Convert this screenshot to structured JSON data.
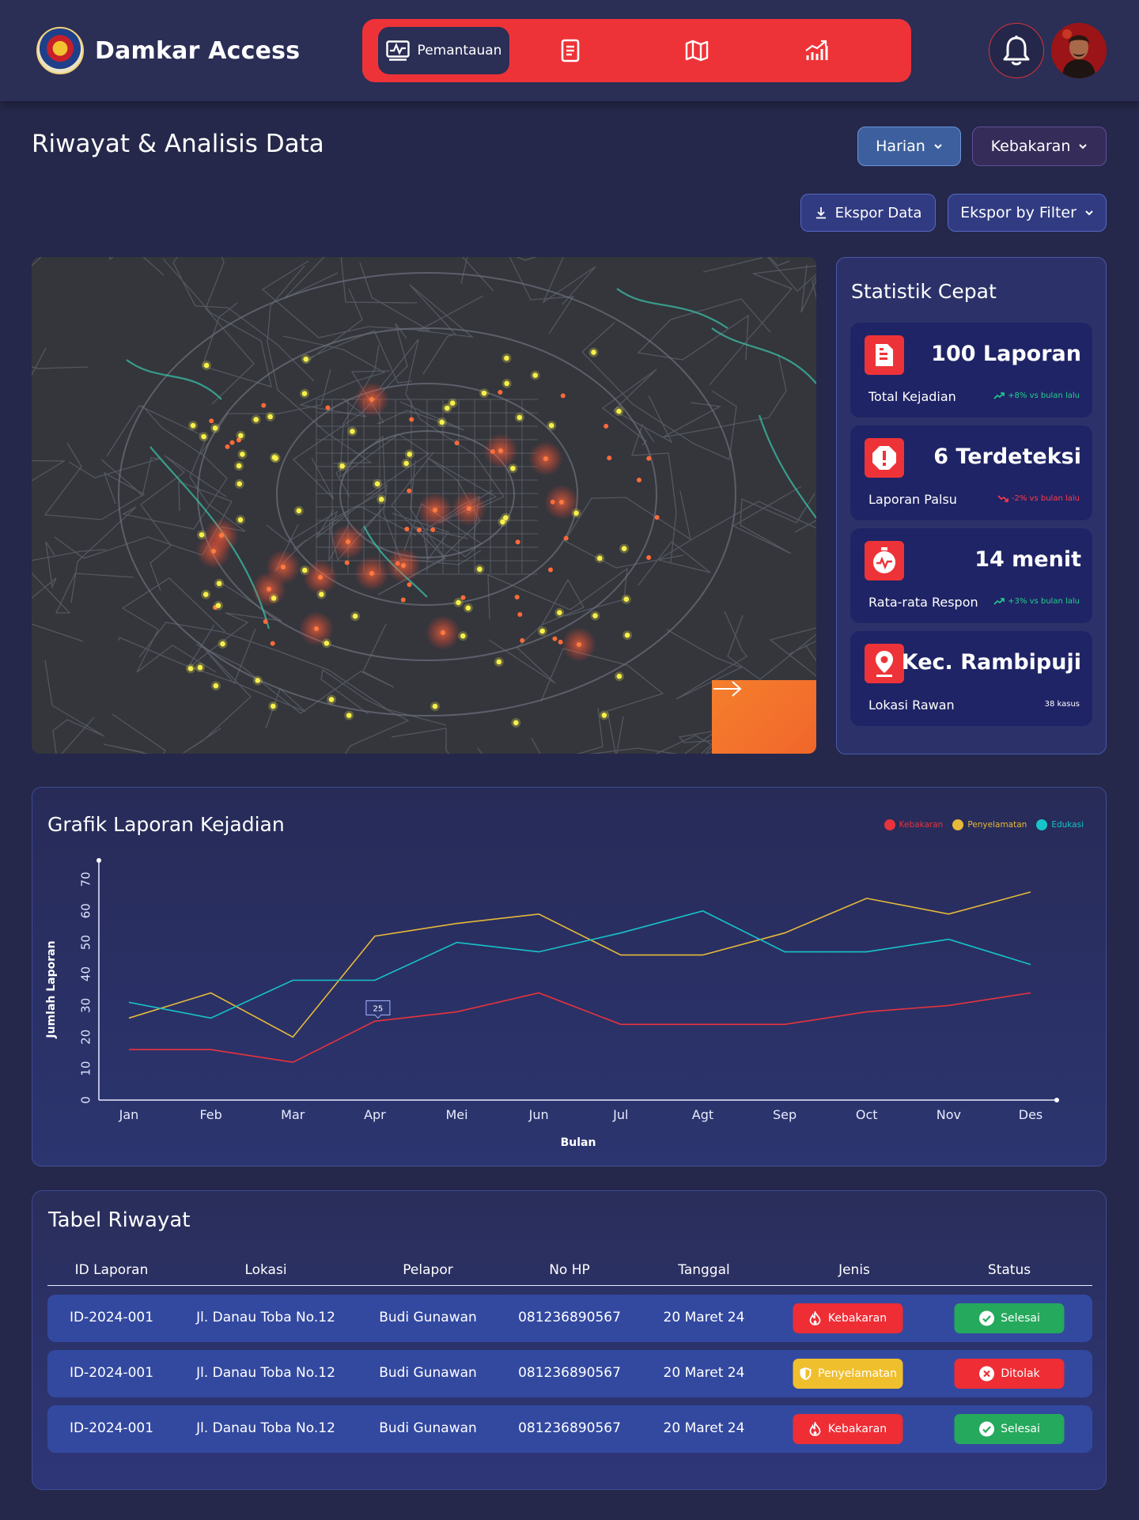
{
  "app": {
    "name": "Damkar Access"
  },
  "nav": {
    "items": [
      {
        "label": "Pemantauan",
        "icon": "monitor-chart-icon"
      },
      {
        "label": "",
        "icon": "document-icon"
      },
      {
        "label": "",
        "icon": "map-icon"
      },
      {
        "label": "",
        "icon": "analytics-icon"
      }
    ]
  },
  "page": {
    "title": "Riwayat & Analisis Data"
  },
  "filters": {
    "period": "Harian",
    "category": "Kebakaran",
    "export": "Ekspor Data",
    "export_filter": "Ekspor by Filter"
  },
  "stats": {
    "title": "Statistik Cepat",
    "cards": [
      {
        "value": "100 Laporan",
        "label": "Total Kejadian",
        "trend": "+8% vs bulan lalu",
        "trend_color": "#23d18b",
        "icon": "document-icon"
      },
      {
        "value": "6 Terdeteksi",
        "label": "Laporan Palsu",
        "trend": "-2% vs bulan lalu",
        "trend_color": "#ff3b45",
        "icon": "alert-octagon-icon"
      },
      {
        "value": "14 menit",
        "label": "Rata-rata Respon",
        "trend": "+3% vs bulan lalu",
        "trend_color": "#23d18b",
        "icon": "stopwatch-icon"
      },
      {
        "value": "Kec. Rambipuji",
        "label": "Lokasi Rawan",
        "trend": "38 kasus",
        "trend_color": "#ffffff",
        "icon": "location-pin-icon"
      }
    ]
  },
  "chart_data": {
    "type": "line",
    "title": "Grafik Laporan Kejadian",
    "xlabel": "Bulan",
    "ylabel": "Jumlah Laporan",
    "categories": [
      "Jan",
      "Feb",
      "Mar",
      "Apr",
      "Mei",
      "Jun",
      "Jul",
      "Agt",
      "Sep",
      "Oct",
      "Nov",
      "Des"
    ],
    "yticks": [
      0,
      10,
      20,
      30,
      40,
      50,
      60,
      70
    ],
    "ylim": [
      0,
      75
    ],
    "legend_position": "top-right",
    "series": [
      {
        "name": "Kebakaran",
        "color": "#e8333d",
        "values": [
          16,
          16,
          12,
          25,
          28,
          34,
          24,
          24,
          24,
          28,
          30,
          34
        ]
      },
      {
        "name": "Penyelamatan",
        "color": "#e6b93b",
        "values": [
          26,
          34,
          20,
          52,
          56,
          59,
          46,
          46,
          53,
          64,
          59,
          66
        ]
      },
      {
        "name": "Edukasi",
        "color": "#17c4c9",
        "values": [
          31,
          26,
          38,
          38,
          50,
          47,
          53,
          60,
          47,
          47,
          51,
          43
        ]
      }
    ],
    "annotation": {
      "label": "25",
      "x": "Apr",
      "series": "Kebakaran"
    },
    "grid": false
  },
  "table": {
    "title": "Tabel Riwayat",
    "columns": [
      "ID Laporan",
      "Lokasi",
      "Pelapor",
      "No HP",
      "Tanggal",
      "Jenis",
      "Status"
    ],
    "rows": [
      {
        "id": "ID-2024-001",
        "lokasi": "Jl. Danau Toba No.12",
        "pelapor": "Budi Gunawan",
        "hp": "081236890567",
        "tanggal": "20 Maret 24",
        "jenis": "Kebakaran",
        "jenis_color": "#ee2d35",
        "status": "Selesai",
        "status_color": "#25a95c"
      },
      {
        "id": "ID-2024-001",
        "lokasi": "Jl. Danau Toba No.12",
        "pelapor": "Budi Gunawan",
        "hp": "081236890567",
        "tanggal": "20 Maret 24",
        "jenis": "Penyelamatan",
        "jenis_color": "#f0bf2e",
        "status": "Ditolak",
        "status_color": "#ee2d35"
      },
      {
        "id": "ID-2024-001",
        "lokasi": "Jl. Danau Toba No.12",
        "pelapor": "Budi Gunawan",
        "hp": "081236890567",
        "tanggal": "20 Maret 24",
        "jenis": "Kebakaran",
        "jenis_color": "#ee2d35",
        "status": "Selesai",
        "status_color": "#25a95c"
      }
    ]
  }
}
